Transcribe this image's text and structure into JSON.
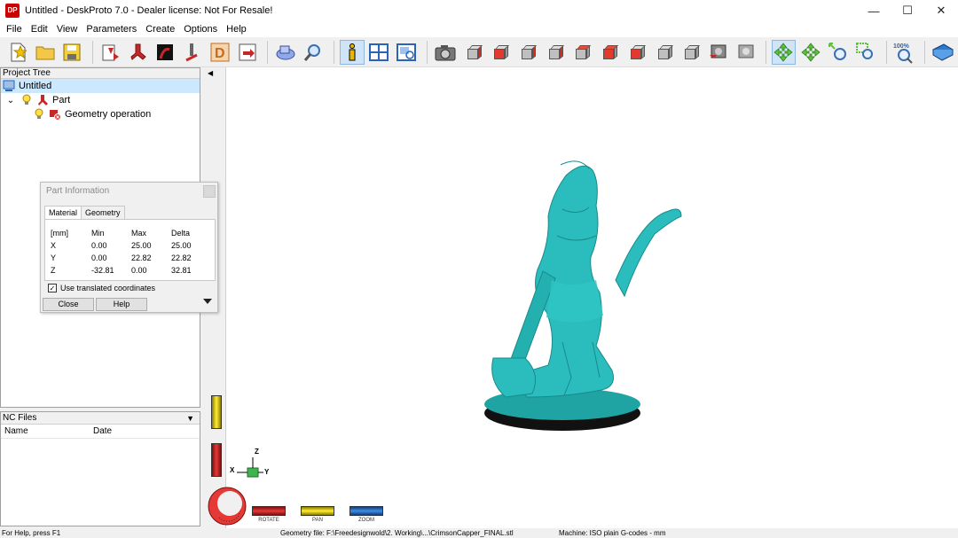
{
  "window": {
    "title": "Untitled - DeskProto 7.0 - Dealer license: Not For Resale!",
    "app_icon_text": "DP"
  },
  "menu": [
    "File",
    "Edit",
    "View",
    "Parameters",
    "Create",
    "Options",
    "Help"
  ],
  "toolbar": {
    "zoom_100_label": "100%"
  },
  "project_tree": {
    "header": "Project Tree",
    "root": "Untitled",
    "part": "Part",
    "operation": "Geometry operation",
    "expander": "⌄"
  },
  "part_info": {
    "caption": "Part Information",
    "tabs": [
      "Material",
      "Geometry"
    ],
    "columns": [
      "[mm]",
      "Min",
      "Max",
      "Delta"
    ],
    "rows": [
      {
        "axis": "X",
        "min": "0.00",
        "max": "25.00",
        "delta": "25.00"
      },
      {
        "axis": "Y",
        "min": "0.00",
        "max": "22.82",
        "delta": "22.82"
      },
      {
        "axis": "Z",
        "min": "-32.81",
        "max": "0.00",
        "delta": "32.81"
      }
    ],
    "use_translated": "Use translated coordinates",
    "use_translated_checked": true,
    "close_label": "Close",
    "help_label": "Help"
  },
  "nc_files": {
    "header": "NC Files",
    "col_name": "Name",
    "col_date": "Date"
  },
  "viewport": {
    "model_color": "#2bbdbd",
    "axis_z": "Z",
    "axis_x": "X",
    "axis_y": "Y",
    "rotate_label": "ROTATE",
    "pan_label": "PAN",
    "zoom_label": "ZOOM"
  },
  "status": {
    "help": "For Help, press F1",
    "geometry_file": "Geometry file: F:\\Freedesignwold\\2. Working\\...\\CrimsonCapper_FINAL.stl",
    "machine": "Machine: ISO plain G-codes - mm"
  }
}
